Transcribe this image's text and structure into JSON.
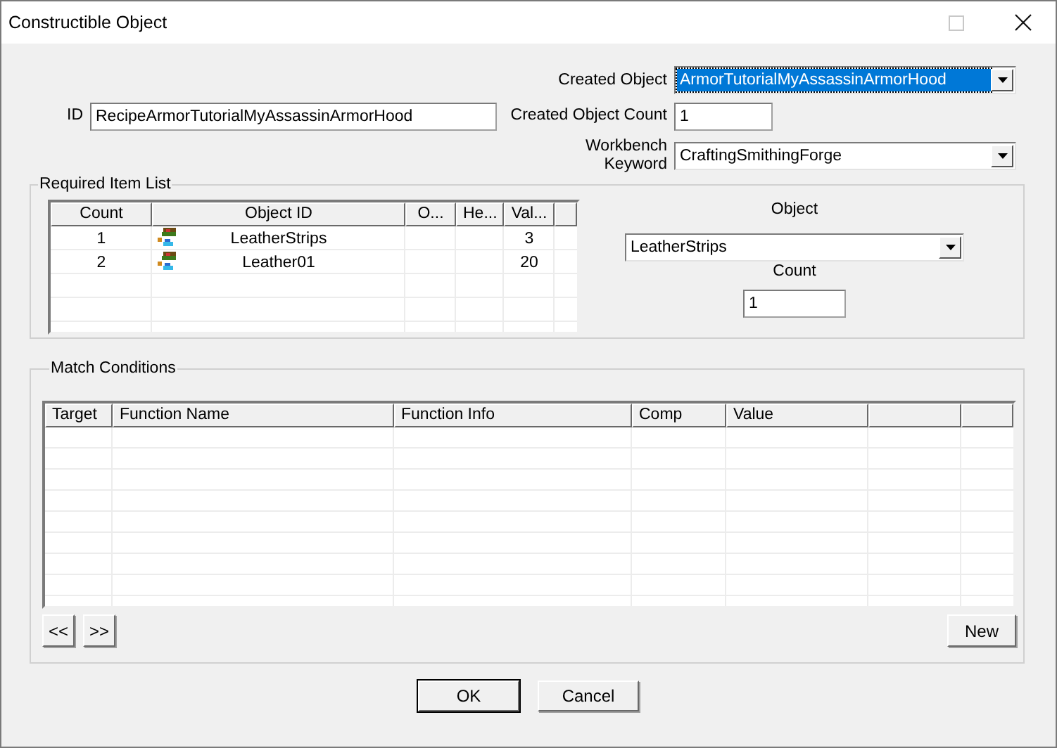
{
  "window": {
    "title": "Constructible Object"
  },
  "id_field": {
    "label": "ID",
    "value": "RecipeArmorTutorialMyAssassinArmorHood"
  },
  "created_object": {
    "label": "Created Object",
    "value": "ArmorTutorialMyAssassinArmorHood",
    "selected": true
  },
  "created_object_count": {
    "label": "Created Object Count",
    "value": "1"
  },
  "workbench_keyword": {
    "label": "Workbench Keyword",
    "value": "CraftingSmithingForge",
    "selected": false
  },
  "required_items": {
    "legend": "Required Item List",
    "columns": [
      "Count",
      "Object ID",
      "O...",
      "He...",
      "Val..."
    ],
    "rows": [
      {
        "count": "1",
        "object_id": "LeatherStrips",
        "value": "3"
      },
      {
        "count": "2",
        "object_id": "Leather01",
        "value": "20"
      }
    ],
    "object_label": "Object",
    "object_value": "LeatherStrips",
    "count_label": "Count",
    "count_value": "1"
  },
  "match_conditions": {
    "legend": "Match Conditions",
    "columns": [
      "Target",
      "Function Name",
      "Function Info",
      "Comp",
      "Value"
    ],
    "prev_button": "<<",
    "next_button": ">>",
    "new_button": "New"
  },
  "buttons": [
    "OK",
    "Cancel"
  ]
}
